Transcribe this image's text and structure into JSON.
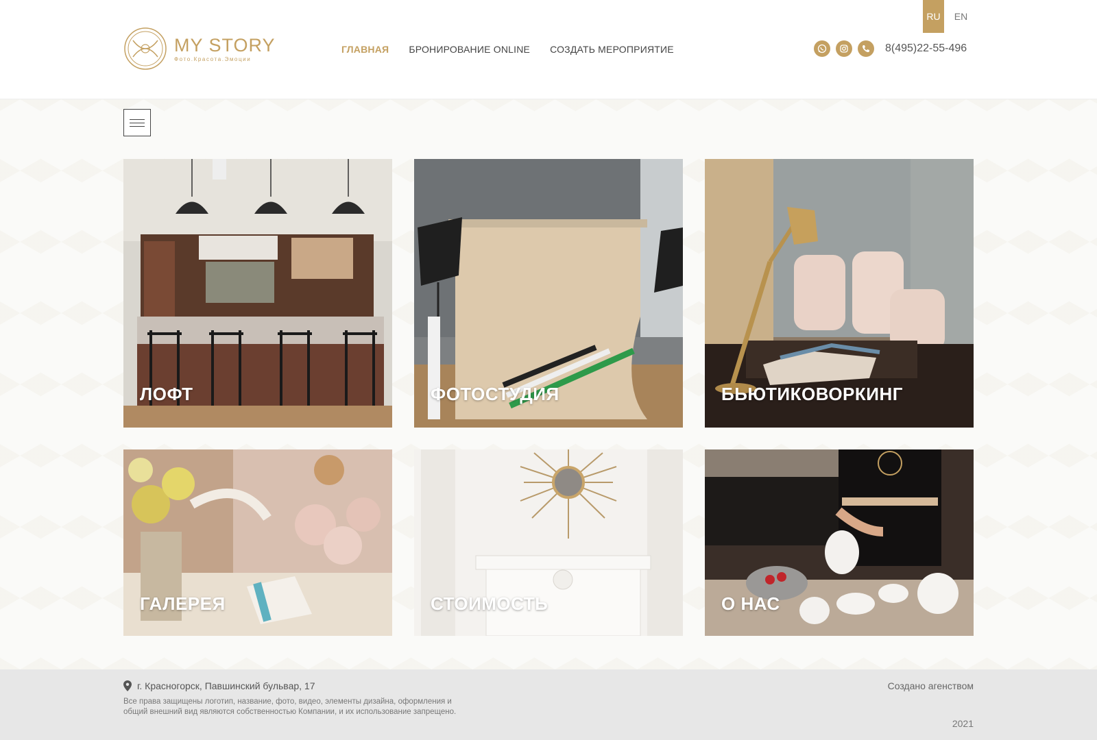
{
  "header": {
    "logo": {
      "title": "MY STORY",
      "subtitle": "Фото.Красота.Эмоции"
    },
    "nav": [
      {
        "label": "ГЛАВНАЯ",
        "active": true
      },
      {
        "label": "БРОНИРОВАНИЕ ONLINE",
        "active": false
      },
      {
        "label": "СОЗДАТЬ МЕРОПРИЯТИЕ",
        "active": false
      }
    ],
    "languages": [
      {
        "label": "RU",
        "active": true
      },
      {
        "label": "EN",
        "active": false
      }
    ],
    "social_icons": [
      "whatsapp-icon",
      "instagram-icon",
      "phone-icon"
    ],
    "phone": "8(495)22-55-496"
  },
  "cards": [
    {
      "label": "ЛОФТ",
      "scene": "kitchen-loft-photo"
    },
    {
      "label": "ФОТОСТУДИЯ",
      "scene": "photo-studio-photo"
    },
    {
      "label": "БЬЮТИКОВОРКИНГ",
      "scene": "beauty-coworking-photo"
    },
    {
      "label": "ГАЛЕРЕЯ",
      "scene": "gallery-table-photo"
    },
    {
      "label": "СТОИМОСТЬ",
      "scene": "fireplace-mirror-photo"
    },
    {
      "label": "О НАС",
      "scene": "tea-service-photo"
    }
  ],
  "footer": {
    "address": "г. Красногорск, Павшинский бульвар, 17",
    "rights": "Все права защищены логотип, название, фото, видео, элементы дизайна, оформления и общий внешний вид являются собственностью Компании, и их использование запрещено.",
    "created_by": "Создано агенством",
    "year": "2021"
  },
  "colors": {
    "accent": "#c4a061",
    "footer_bg": "#e7e7e7",
    "text": "#444444"
  }
}
